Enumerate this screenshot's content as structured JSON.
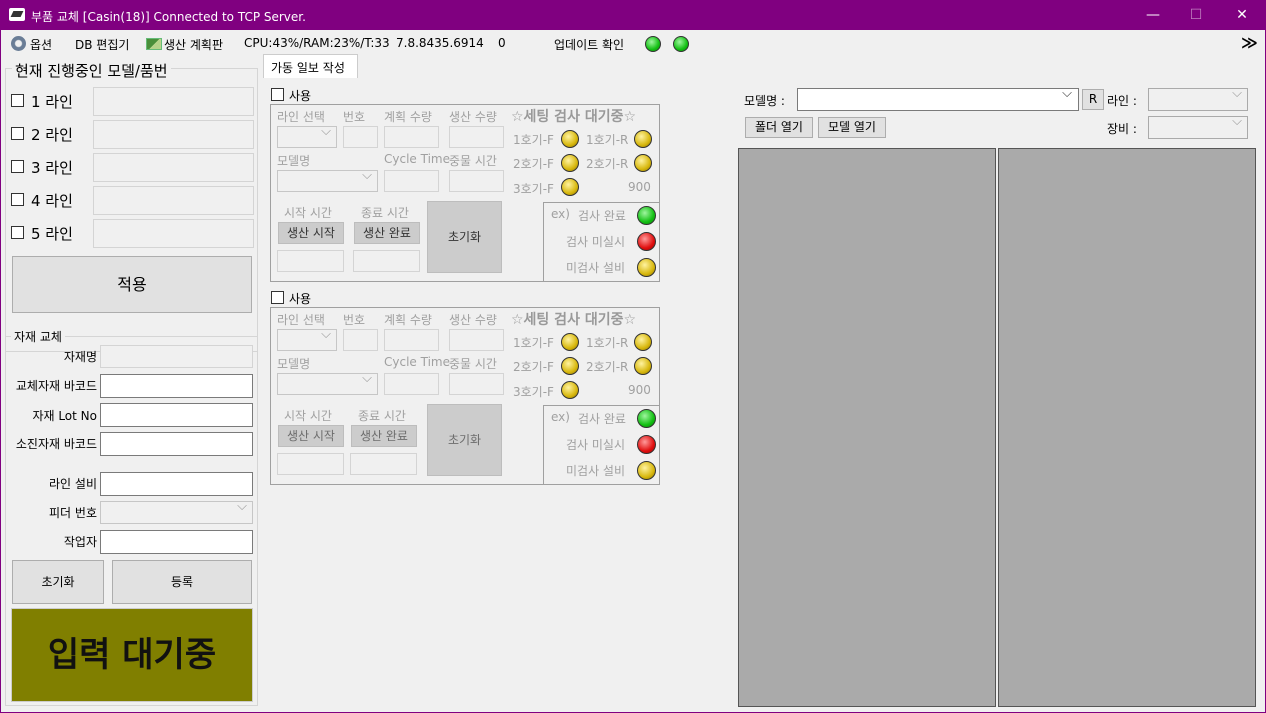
{
  "window": {
    "title": "부품 교체 [Casin(18)] Connected to TCP Server.",
    "minimize": "—",
    "maximize": "☐",
    "close": "✕"
  },
  "menu": {
    "options": "옵션",
    "db_editor": "DB 편집기",
    "production_plan": "생산 계획판",
    "stats": "CPU:43%/RAM:23%/T:33",
    "version": "7.8.8435.6914",
    "count": "0",
    "update_check": "업데이트 확인",
    "expand": "≫"
  },
  "left": {
    "group_title": "현재 진행중인 모델/품번",
    "lines": [
      "1 라인",
      "2 라인",
      "3 라인",
      "4 라인",
      "5 라인"
    ],
    "apply_button": "적용"
  },
  "material": {
    "group_title": "자재 교체",
    "fields": {
      "name": "자재명",
      "replace_barcode": "교체자재 바코드",
      "lot_no": "자재 Lot No",
      "consumed_barcode": "소진자재 바코드",
      "line_equipment": "라인 설비",
      "feeder_no": "피더 번호",
      "worker": "작업자"
    },
    "reset_button": "초기화",
    "register_button": "등록",
    "status": "입력 대기중"
  },
  "tab": {
    "label": "가동 일보 작성"
  },
  "blocks": [
    {
      "use": "사용",
      "line_select": "라인 선택",
      "number": "번호",
      "plan_qty": "계획 수량",
      "prod_qty": "생산 수량",
      "model_name": "모델명",
      "cycle_time": "Cycle Time",
      "stop_time": "중물 시간",
      "start_time": "시작 시간",
      "end_time": "종료 시간",
      "start_button": "생산 시작",
      "end_button": "생산 완료",
      "reset_button": "초기화",
      "setting_title": "☆세팅 검사 대기중☆",
      "f1": "1호기-F",
      "r1": "1호기-R",
      "f2": "2호기-F",
      "r2": "2호기-R",
      "f3": "3호기-F",
      "value": "900",
      "ex": "ex)",
      "legend_done": "검사 완료",
      "legend_not": "검사 미실시",
      "legend_uninspected": "미검사 설비"
    },
    {
      "use": "사용",
      "line_select": "라인 선택",
      "number": "번호",
      "plan_qty": "계획 수량",
      "prod_qty": "생산 수량",
      "model_name": "모델명",
      "cycle_time": "Cycle Time",
      "stop_time": "중물 시간",
      "start_time": "시작 시간",
      "end_time": "종료 시간",
      "start_button": "생산 시작",
      "end_button": "생산 완료",
      "reset_button": "초기화",
      "setting_title": "☆세팅 검사 대기중☆",
      "f1": "1호기-F",
      "r1": "1호기-R",
      "f2": "2호기-F",
      "r2": "2호기-R",
      "f3": "3호기-F",
      "value": "900",
      "ex": "ex)",
      "legend_done": "검사 완료",
      "legend_not": "검사 미실시",
      "legend_uninspected": "미검사 설비"
    }
  ],
  "right": {
    "model_label": "모델명 :",
    "r_button": "R",
    "line_label": "라인 :",
    "equipment_label": "장비 :",
    "open_folder": "폴더 열기",
    "open_model": "모델 열기"
  }
}
